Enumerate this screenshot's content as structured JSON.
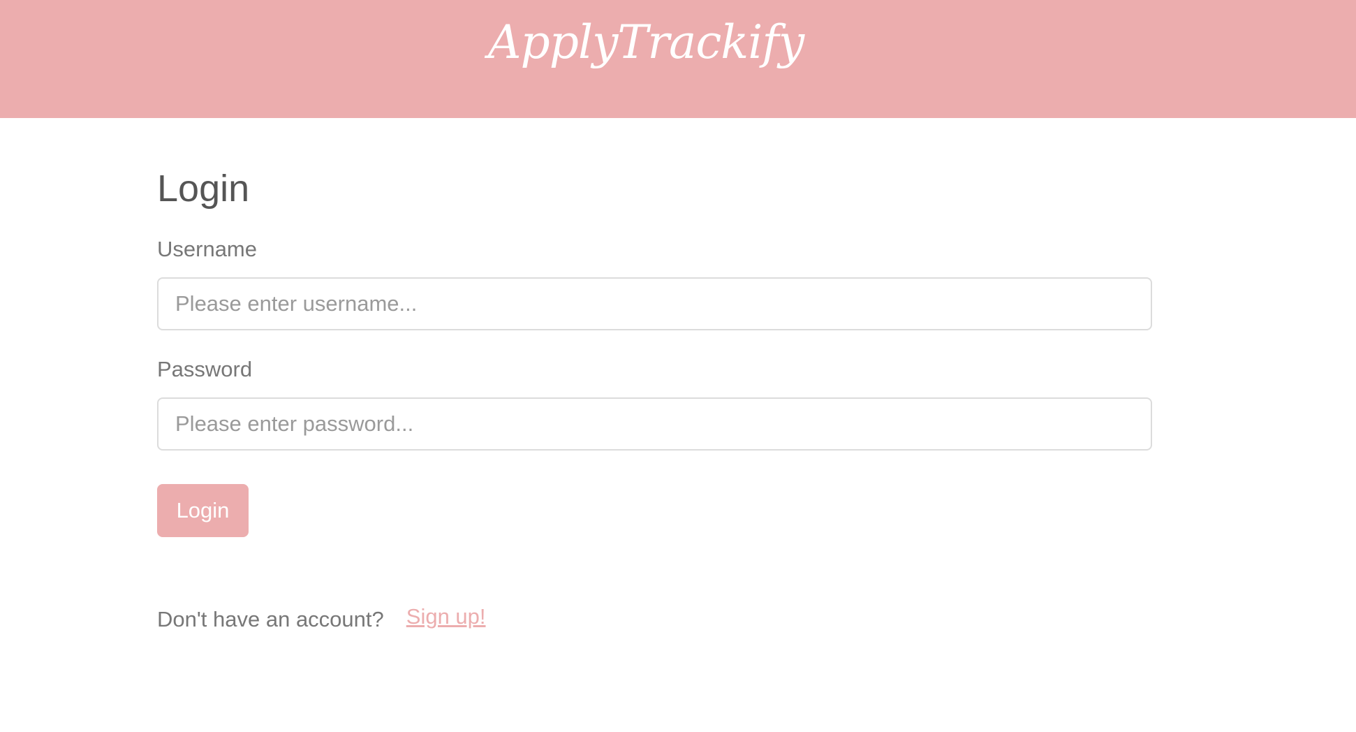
{
  "header": {
    "brand": "ApplyTrackify"
  },
  "login": {
    "title": "Login",
    "username_label": "Username",
    "username_placeholder": "Please enter username...",
    "username_value": "",
    "password_label": "Password",
    "password_placeholder": "Please enter password...",
    "password_value": "",
    "submit_label": "Login"
  },
  "signup": {
    "prompt": "Don't have an account?",
    "link_label": "Sign up!"
  },
  "colors": {
    "accent": "#ecadae",
    "heading_text": "#555555",
    "label_text": "#777777",
    "placeholder_text": "#9a9a9a",
    "input_border": "#dcdcdc"
  }
}
